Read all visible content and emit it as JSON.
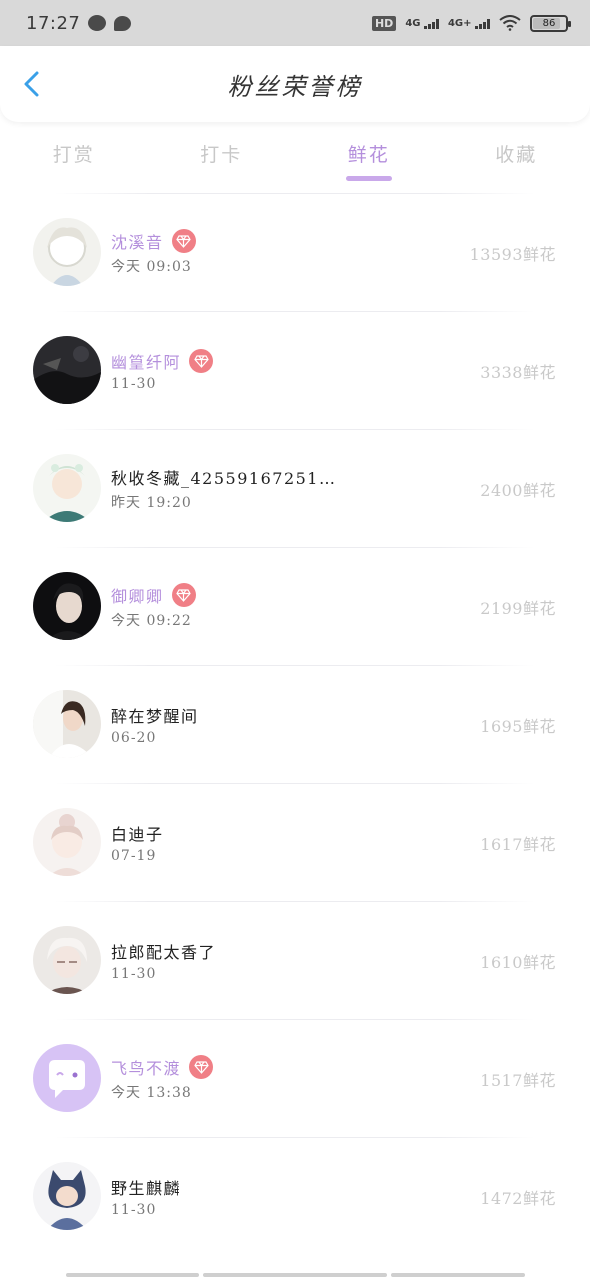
{
  "status_bar": {
    "time": "17:27",
    "hd": "HD",
    "net1": "4G",
    "net2": "4G+",
    "battery": "86",
    "battery_level": 0.86,
    "icons": [
      "wechat-icon",
      "chat-icon",
      "wifi-icon",
      "battery-icon"
    ]
  },
  "header": {
    "title": "粉丝荣誉榜",
    "back_icon": "chevron-left-icon"
  },
  "tabs": [
    {
      "label": "打赏",
      "active": false
    },
    {
      "label": "打卡",
      "active": false
    },
    {
      "label": "鲜花",
      "active": true
    },
    {
      "label": "收藏",
      "active": false
    }
  ],
  "list": [
    {
      "name": "沈溪音",
      "time": "今天  09:03",
      "count": "13593鲜花",
      "vip": true
    },
    {
      "name": "幽篁纤阿",
      "time": "11-30",
      "count": "3338鲜花",
      "vip": true
    },
    {
      "name": "秋收冬藏_42559167251…",
      "time": "昨天  19:20",
      "count": "2400鲜花",
      "vip": false
    },
    {
      "name": "御卿卿",
      "time": "今天  09:22",
      "count": "2199鲜花",
      "vip": true
    },
    {
      "name": "醉在梦醒间",
      "time": "06-20",
      "count": "1695鲜花",
      "vip": false
    },
    {
      "name": "白迪子",
      "time": "07-19",
      "count": "1617鲜花",
      "vip": false
    },
    {
      "name": "拉郎配太香了",
      "time": "11-30",
      "count": "1610鲜花",
      "vip": false
    },
    {
      "name": "飞鸟不渡",
      "time": "今天  13:38",
      "count": "1517鲜花",
      "vip": true
    },
    {
      "name": "野生麒麟",
      "time": "11-30",
      "count": "1472鲜花",
      "vip": false
    }
  ],
  "colors": {
    "accent": "#b48fdc",
    "underline": "#c9a8ea",
    "vip_badge": "#f07f86",
    "count": "#c9c9c9",
    "status_bar": "#d9d9d9"
  }
}
